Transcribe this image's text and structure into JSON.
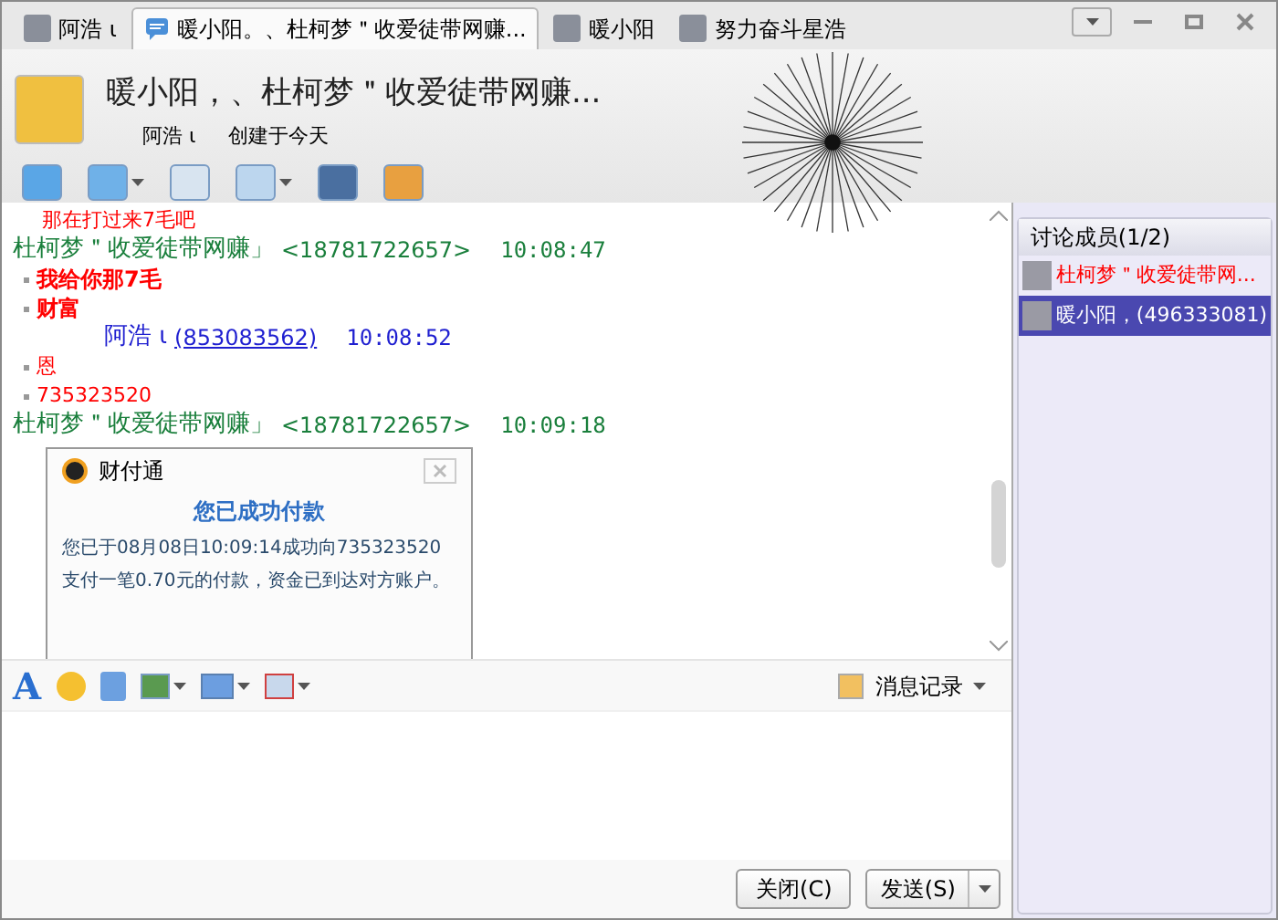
{
  "tabs": [
    {
      "label": "阿浩 ι",
      "kind": "person",
      "selected": false
    },
    {
      "label": "暖小阳。、杜柯梦＂收爱徒带网赚...",
      "kind": "group",
      "selected": true
    },
    {
      "label": "暖小阳",
      "kind": "person",
      "selected": false
    },
    {
      "label": "努力奋斗星浩",
      "kind": "person",
      "selected": false
    }
  ],
  "header": {
    "title": "暖小阳，、杜柯梦＂收爱徒带网赚...",
    "creator": "阿浩 ι",
    "created": "创建于今天"
  },
  "messages": [
    {
      "kind": "line",
      "text": "那在打过来7毛吧"
    },
    {
      "kind": "incoming_header",
      "name": "杜柯梦＂收爱徒带网赚」",
      "id": "<18781722657>",
      "time": "10:08:47"
    },
    {
      "kind": "bullet",
      "text": "我给你那7毛",
      "bold": true
    },
    {
      "kind": "bullet",
      "text": "财富",
      "bold": true
    },
    {
      "kind": "own_header",
      "name": "阿浩 ι",
      "id": "(853083562)",
      "time": "10:08:52"
    },
    {
      "kind": "bullet",
      "text": "恩",
      "bold": false
    },
    {
      "kind": "bullet",
      "text": "735323520",
      "bold": false
    },
    {
      "kind": "incoming_header",
      "name": "杜柯梦＂收爱徒带网赚」",
      "id": "<18781722657>",
      "time": "10:09:18"
    },
    {
      "kind": "card",
      "app": "财付通",
      "heading": "您已成功付款",
      "body": "您已于08月08日10:09:14成功向735323520支付一笔0.70元的付款，资金已到达对方账户。"
    }
  ],
  "font_button": "A",
  "history_button": "消息记录",
  "buttons": {
    "close": "关闭(C)",
    "send": "发送(S)"
  },
  "members": {
    "title": "讨论成员(1/2)",
    "items": [
      {
        "name": "杜柯梦＂收爱徒带网...",
        "highlight": true,
        "selected": false
      },
      {
        "name": "暖小阳，(496333081)",
        "highlight": false,
        "selected": true
      }
    ]
  }
}
